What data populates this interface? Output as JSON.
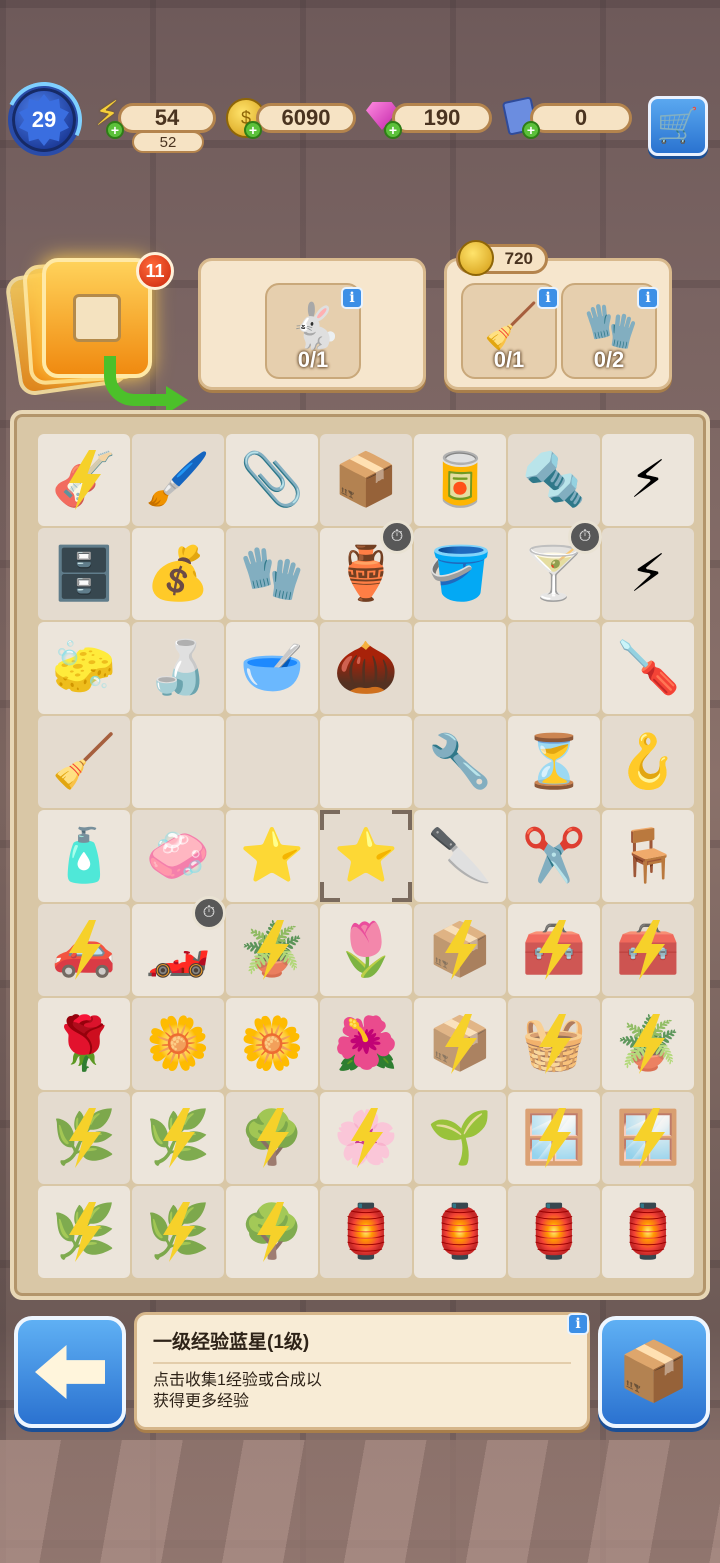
{
  "hud": {
    "level": "29",
    "energy": "54",
    "energy_max": "52",
    "coins": "6090",
    "gems": "190",
    "tickets": "0"
  },
  "orders": {
    "stack_count": "11",
    "reward": "720",
    "req1": [
      {
        "icon": "rabbit-statue-icon",
        "glyph": "🐇",
        "count": "0/1"
      }
    ],
    "req2": [
      {
        "icon": "rake-icon",
        "glyph": "🧹",
        "count": "0/1"
      },
      {
        "icon": "gloves-icon",
        "glyph": "🧤",
        "count": "0/2"
      }
    ]
  },
  "board": {
    "rows": [
      [
        {
          "name": "locked-guitar",
          "glyph": "🎸",
          "locked": true
        },
        {
          "name": "makeup-brush",
          "glyph": "🖌️"
        },
        {
          "name": "hairpin",
          "glyph": "📎"
        },
        {
          "name": "box-of-screws",
          "glyph": "📦"
        },
        {
          "name": "paint-can-lid",
          "glyph": "🥫"
        },
        {
          "name": "screws",
          "glyph": "🔩"
        },
        {
          "name": "energy-orb",
          "glyph": "⚡"
        }
      ],
      [
        {
          "name": "safe",
          "glyph": "🗄️"
        },
        {
          "name": "money-bag",
          "glyph": "💰"
        },
        {
          "name": "work-gloves",
          "glyph": "🧤"
        },
        {
          "name": "blue-vase",
          "glyph": "🏺",
          "timer": true
        },
        {
          "name": "paint-bucket",
          "glyph": "🪣"
        },
        {
          "name": "goblet-vase",
          "glyph": "🍸",
          "timer": true
        },
        {
          "name": "energy-orb-small",
          "glyph": "⚡"
        }
      ],
      [
        {
          "name": "squeegee",
          "glyph": "🧽"
        },
        {
          "name": "spray-bottle",
          "glyph": "🍶"
        },
        {
          "name": "seed-bowl",
          "glyph": "🥣"
        },
        {
          "name": "seeds",
          "glyph": "🌰"
        },
        {
          "name": "empty",
          "glyph": ""
        },
        {
          "name": "empty",
          "glyph": ""
        },
        {
          "name": "screwdriver",
          "glyph": "🪛"
        }
      ],
      [
        {
          "name": "broom",
          "glyph": "🧹"
        },
        {
          "name": "empty",
          "glyph": ""
        },
        {
          "name": "empty",
          "glyph": ""
        },
        {
          "name": "empty",
          "glyph": ""
        },
        {
          "name": "wrench",
          "glyph": "🔧"
        },
        {
          "name": "hourglass-orb",
          "glyph": "⏳"
        },
        {
          "name": "crowbar",
          "glyph": "🪝"
        }
      ],
      [
        {
          "name": "soap-bottle",
          "glyph": "🧴"
        },
        {
          "name": "soap-bar",
          "glyph": "🧼"
        },
        {
          "name": "blue-star",
          "glyph": "⭐"
        },
        {
          "name": "blue-star-selected",
          "glyph": "⭐",
          "selected": true
        },
        {
          "name": "knife",
          "glyph": "🔪"
        },
        {
          "name": "pruning-shears",
          "glyph": "✂️"
        },
        {
          "name": "wooden-chair",
          "glyph": "🪑"
        }
      ],
      [
        {
          "name": "locked-toy-car",
          "glyph": "🚗",
          "locked": true
        },
        {
          "name": "toy-car",
          "glyph": "🏎️",
          "timer": true
        },
        {
          "name": "locked-planter",
          "glyph": "🪴",
          "locked": true
        },
        {
          "name": "tulip-pot",
          "glyph": "🌷"
        },
        {
          "name": "locked-crate",
          "glyph": "📦",
          "locked": true
        },
        {
          "name": "locked-toolbox",
          "glyph": "🧰",
          "locked": true
        },
        {
          "name": "locked-toolbox-2",
          "glyph": "🧰",
          "locked": true
        }
      ],
      [
        {
          "name": "rose-pot",
          "glyph": "🌹"
        },
        {
          "name": "flower-pot",
          "glyph": "🌼"
        },
        {
          "name": "flower-pot-2",
          "glyph": "🌼"
        },
        {
          "name": "rose-pot-2",
          "glyph": "🌺"
        },
        {
          "name": "locked-crates",
          "glyph": "📦",
          "locked": true
        },
        {
          "name": "locked-basket",
          "glyph": "🧺",
          "locked": true
        },
        {
          "name": "locked-planter-2",
          "glyph": "🪴",
          "locked": true
        }
      ],
      [
        {
          "name": "locked-sprout",
          "glyph": "🌿",
          "locked": true
        },
        {
          "name": "locked-sprout-2",
          "glyph": "🌿",
          "locked": true
        },
        {
          "name": "locked-shrub",
          "glyph": "🌳",
          "locked": true
        },
        {
          "name": "locked-flower-shrub",
          "glyph": "🌸",
          "locked": true
        },
        {
          "name": "sapling-pot",
          "glyph": "🌱"
        },
        {
          "name": "locked-window",
          "glyph": "🪟",
          "locked": true
        },
        {
          "name": "locked-window-2",
          "glyph": "🪟",
          "locked": true
        }
      ],
      [
        {
          "name": "locked-sprout-3",
          "glyph": "🌿",
          "locked": true
        },
        {
          "name": "locked-sprout-4",
          "glyph": "🌿",
          "locked": true
        },
        {
          "name": "locked-shrub-2",
          "glyph": "🌳",
          "locked": true
        },
        {
          "name": "lantern",
          "glyph": "🏮"
        },
        {
          "name": "lantern-2",
          "glyph": "🏮"
        },
        {
          "name": "lantern-3",
          "glyph": "🏮"
        },
        {
          "name": "lantern-4",
          "glyph": "🏮"
        }
      ]
    ]
  },
  "info": {
    "title": "一级经验蓝星(1级)",
    "desc": "点击收集1经验或合成以获得更多经验"
  },
  "colors": {
    "accent_blue": "#2b72d0",
    "panel_cream": "#f6e6cd",
    "bolt_yellow": "#f6d12a"
  }
}
